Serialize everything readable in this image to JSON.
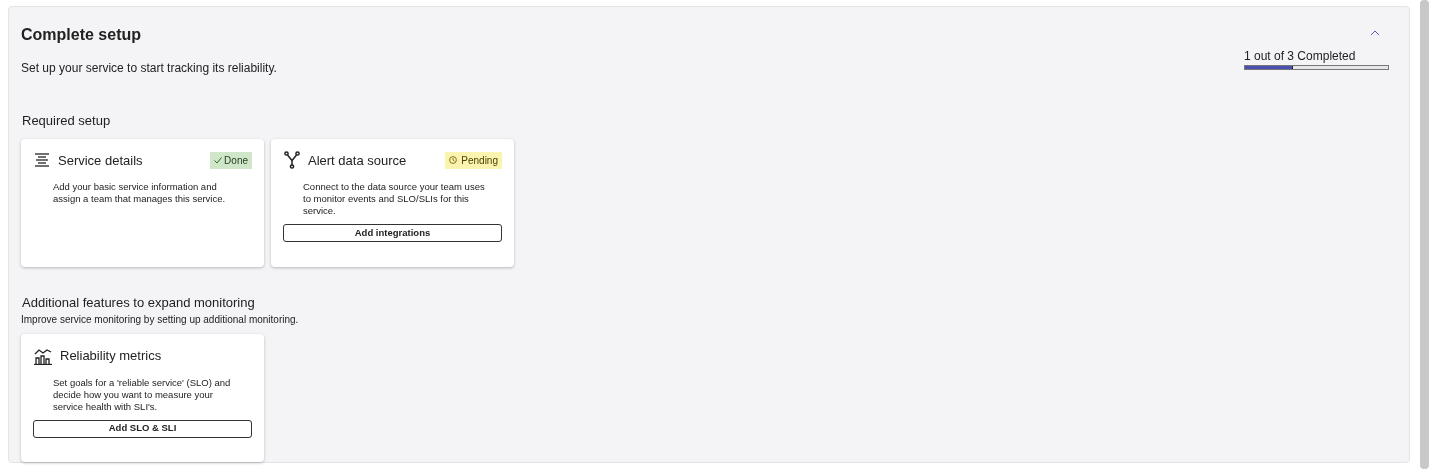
{
  "panel": {
    "title": "Complete setup",
    "subtitle": "Set up your service to start tracking its reliability.",
    "expanded": true,
    "progress": {
      "label": "1 out of 3 Completed",
      "level": 0.333
    }
  },
  "sections": [
    {
      "title": "Required setup",
      "cards": [
        {
          "kind": "details",
          "title": "Service details",
          "status": {
            "kind": "done",
            "label": "Done"
          },
          "description": "Add your basic service information and assign a team that manages this service."
        },
        {
          "kind": "source",
          "title": "Alert data source",
          "status": {
            "kind": "pending",
            "label": "Pending"
          },
          "description": "Connect to the data source your team uses to monitor events and SLO/SLIs for this service.",
          "button": "Add integrations"
        }
      ]
    },
    {
      "title": "Additional features to expand monitoring",
      "subtitle": "Improve service monitoring by setting up additional monitoring.",
      "cards": [
        {
          "kind": "metrics",
          "title": "Reliability metrics",
          "description": "Set goals for a 'reliable service' (SLO) and decide how you want to measure your service health with SLI's.",
          "button": "Add SLO & SLI"
        }
      ]
    }
  ]
}
